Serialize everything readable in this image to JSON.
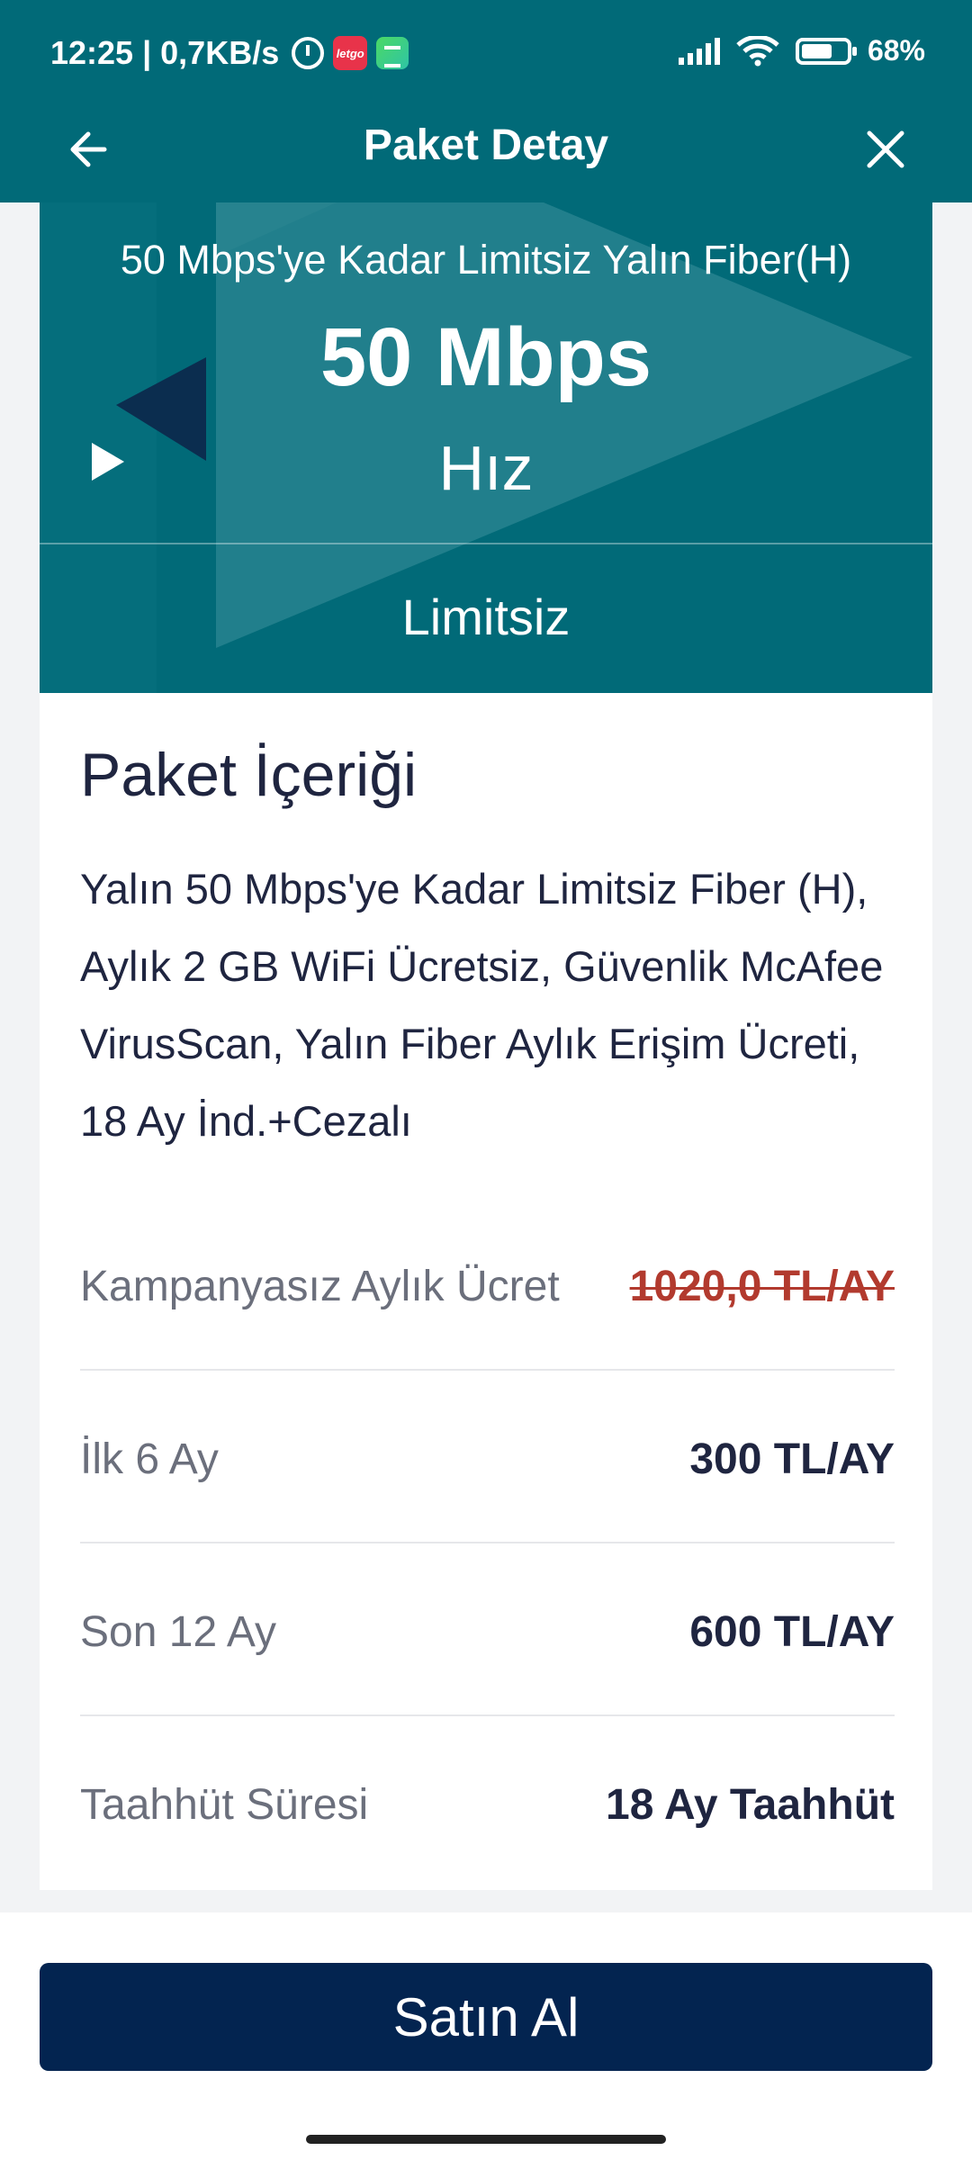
{
  "status_bar": {
    "time_speed": "12:25 | 0,7KB/s",
    "letgo_label": "letgo",
    "battery": "68%",
    "battery_level": 0.68
  },
  "app_bar": {
    "title": "Paket Detay",
    "back_icon": "arrow-left-icon",
    "close_icon": "close-icon"
  },
  "hero": {
    "package_name": "50 Mbps'ye Kadar Limitsiz Yalın Fiber(H)",
    "speed": "50 Mbps",
    "speed_label": "Hız",
    "quota": "Limitsiz",
    "colors": {
      "background": "#016a78",
      "accent": "#0b2d4f"
    }
  },
  "content": {
    "title": "Paket İçeriği",
    "description": "Yalın 50 Mbps'ye Kadar Limitsiz Fiber (H), Aylık 2 GB WiFi Ücretsiz, Güvenlik McAfee VirusScan, Yalın Fiber Aylık Erişim Ücreti, 18 Ay İnd.+Cezalı",
    "rows": [
      {
        "label": "Kampanyasız Aylık Ücret",
        "value": "1020,0 TL/AY"
      },
      {
        "label": "İlk 6 Ay",
        "value": "300 TL/AY"
      },
      {
        "label": "Son 12 Ay",
        "value": "600 TL/AY"
      },
      {
        "label": "Taahhüt Süresi",
        "value": "18 Ay Taahhüt"
      }
    ]
  },
  "footer": {
    "buy_label": "Satın Al",
    "button_color": "#032450"
  }
}
